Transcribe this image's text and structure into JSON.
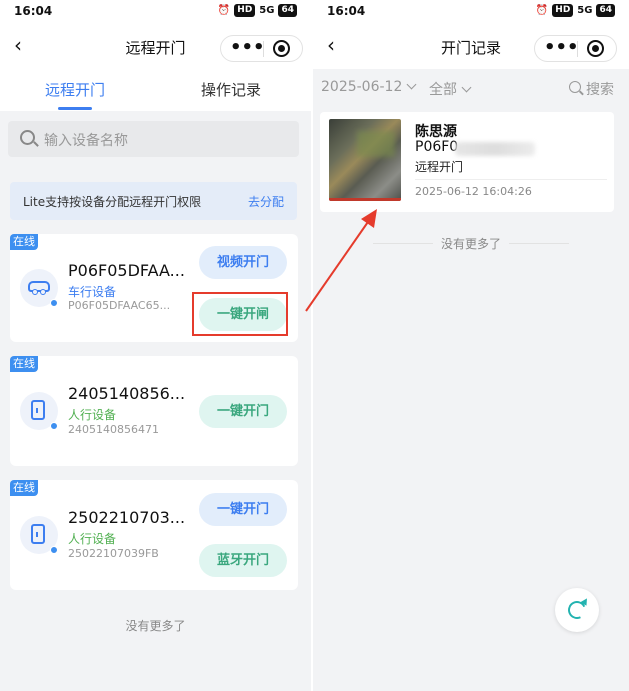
{
  "left": {
    "status": {
      "time": "16:04",
      "hd": "HD",
      "signal": "5G",
      "battery": "64"
    },
    "nav": {
      "back": "‹",
      "title": "远程开门",
      "more": "•••"
    },
    "tabs": [
      {
        "label": "远程开门"
      },
      {
        "label": "操作记录"
      }
    ],
    "search": {
      "placeholder": "输入设备名称"
    },
    "notice": {
      "text": "Lite支持按设备分配远程开门权限",
      "link": "去分配"
    },
    "devices": [
      {
        "badge": "在线",
        "name": "P06F05DFAA...",
        "type": "车行设备",
        "sn": "P06F05DFAAC65...",
        "buttons": [
          "视频开门",
          "一键开闸"
        ]
      },
      {
        "badge": "在线",
        "name": "2405140856...",
        "type": "人行设备",
        "sn": "2405140856471",
        "buttons": [
          "一键开门"
        ]
      },
      {
        "badge": "在线",
        "name": "2502210703...",
        "type": "人行设备",
        "sn": "25022107039FB",
        "buttons": [
          "一键开门",
          "蓝牙开门"
        ]
      }
    ],
    "footer": "没有更多了"
  },
  "right": {
    "status": {
      "time": "16:04",
      "hd": "HD",
      "signal": "5G",
      "battery": "64"
    },
    "nav": {
      "back": "‹",
      "title": "开门记录",
      "more": "•••"
    },
    "filter": {
      "date": "2025-06-12",
      "scope": "全部",
      "search": "搜索"
    },
    "record": {
      "name": "陈思源",
      "sn": "P06F0",
      "type": "远程开门",
      "time": "2025-06-12 16:04:26"
    },
    "footer": "没有更多了"
  },
  "colors": {
    "accent": "#3d7ef0",
    "online_badge": "#3d8ff0",
    "green_button": "#3aa77e",
    "highlight": "#e53b2c"
  }
}
